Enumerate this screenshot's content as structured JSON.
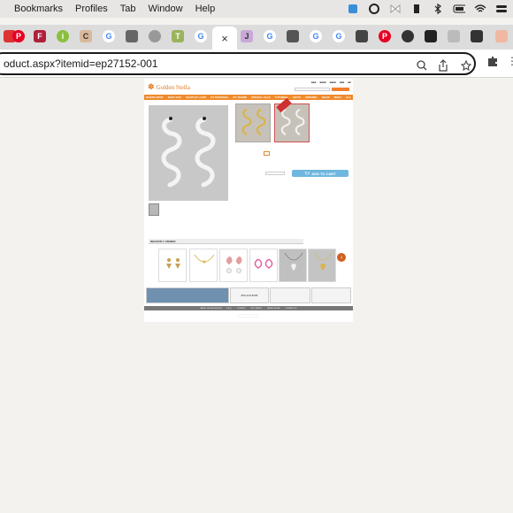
{
  "menubar": {
    "items": [
      "Bookmarks",
      "Profiles",
      "Tab",
      "Window",
      "Help"
    ]
  },
  "tabs": {
    "active_close": "×"
  },
  "address": {
    "url": "oduct.aspx?itemid=ep27152-001"
  },
  "site": {
    "logo": "Golden Stella",
    "nav": [
      "GRAPE SPOT",
      "DAILY DAY",
      "SHOP BY LOOK",
      "BY MATERIAL",
      "BY THEME",
      "SPECIAL SALE",
      "TUTORIAL",
      "GIFTS",
      "APPAREL",
      "BAGS",
      "MEET",
      "ALL"
    ],
    "add_to_cart": "ADD TO CART",
    "recently_viewed": "RECENTLY VIEWED",
    "promo_phone": "800-343-8268",
    "footer_links": [
      "ABOUT GOLDEN STELLA",
      "F.A.Q.",
      "CONTACT",
      "GIFT CARDS",
      "TERMS OF USE",
      "CONTACT US"
    ]
  },
  "colors": {
    "brand": "#f08a2c",
    "cart": "#6fb6e0"
  }
}
